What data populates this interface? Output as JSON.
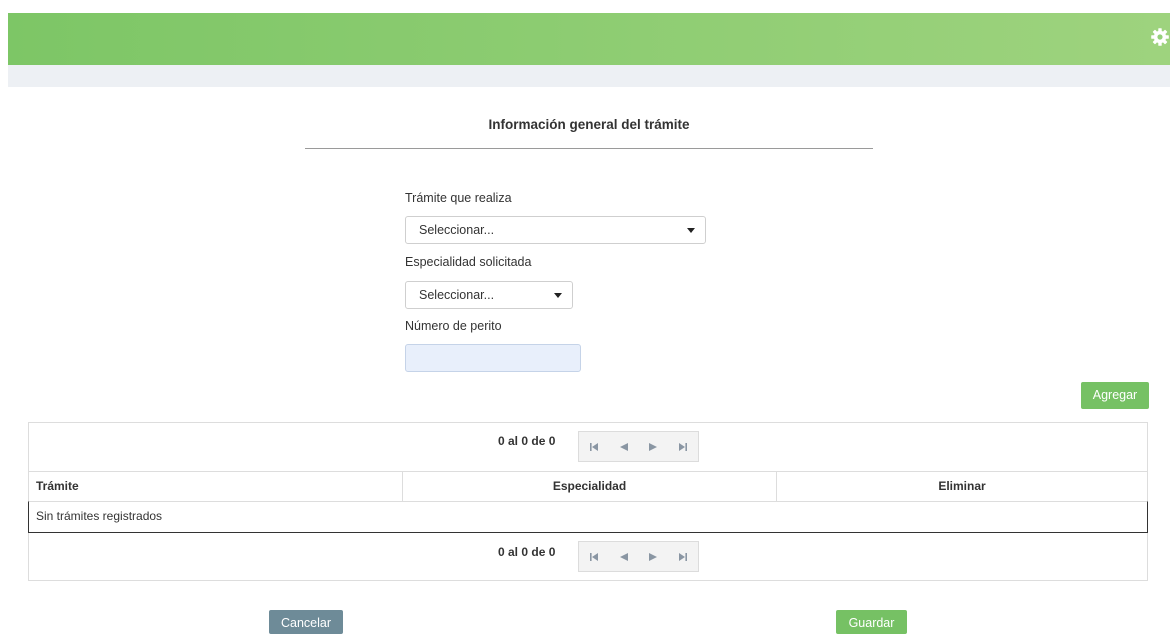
{
  "header": {
    "settings_icon": "gear-icon",
    "accent_color": "#8fcd72"
  },
  "form": {
    "title": "Información general del trámite",
    "tramite": {
      "label": "Trámite que realiza",
      "value": "Seleccionar..."
    },
    "especialidad": {
      "label": "Especialidad solicitada",
      "value": "Seleccionar..."
    },
    "perito": {
      "label": "Número de perito",
      "value": ""
    },
    "add_label": "Agregar"
  },
  "table": {
    "pager_top": "0 al 0 de 0",
    "pager_bottom": "0 al 0 de 0",
    "pager_icons": [
      "first-page-icon",
      "prev-page-icon",
      "next-page-icon",
      "last-page-icon"
    ],
    "columns": [
      "Trámite",
      "Especialidad",
      "Eliminar"
    ],
    "empty_message": "Sin trámites registrados"
  },
  "actions": {
    "cancel_label": "Cancelar",
    "save_label": "Guardar"
  }
}
